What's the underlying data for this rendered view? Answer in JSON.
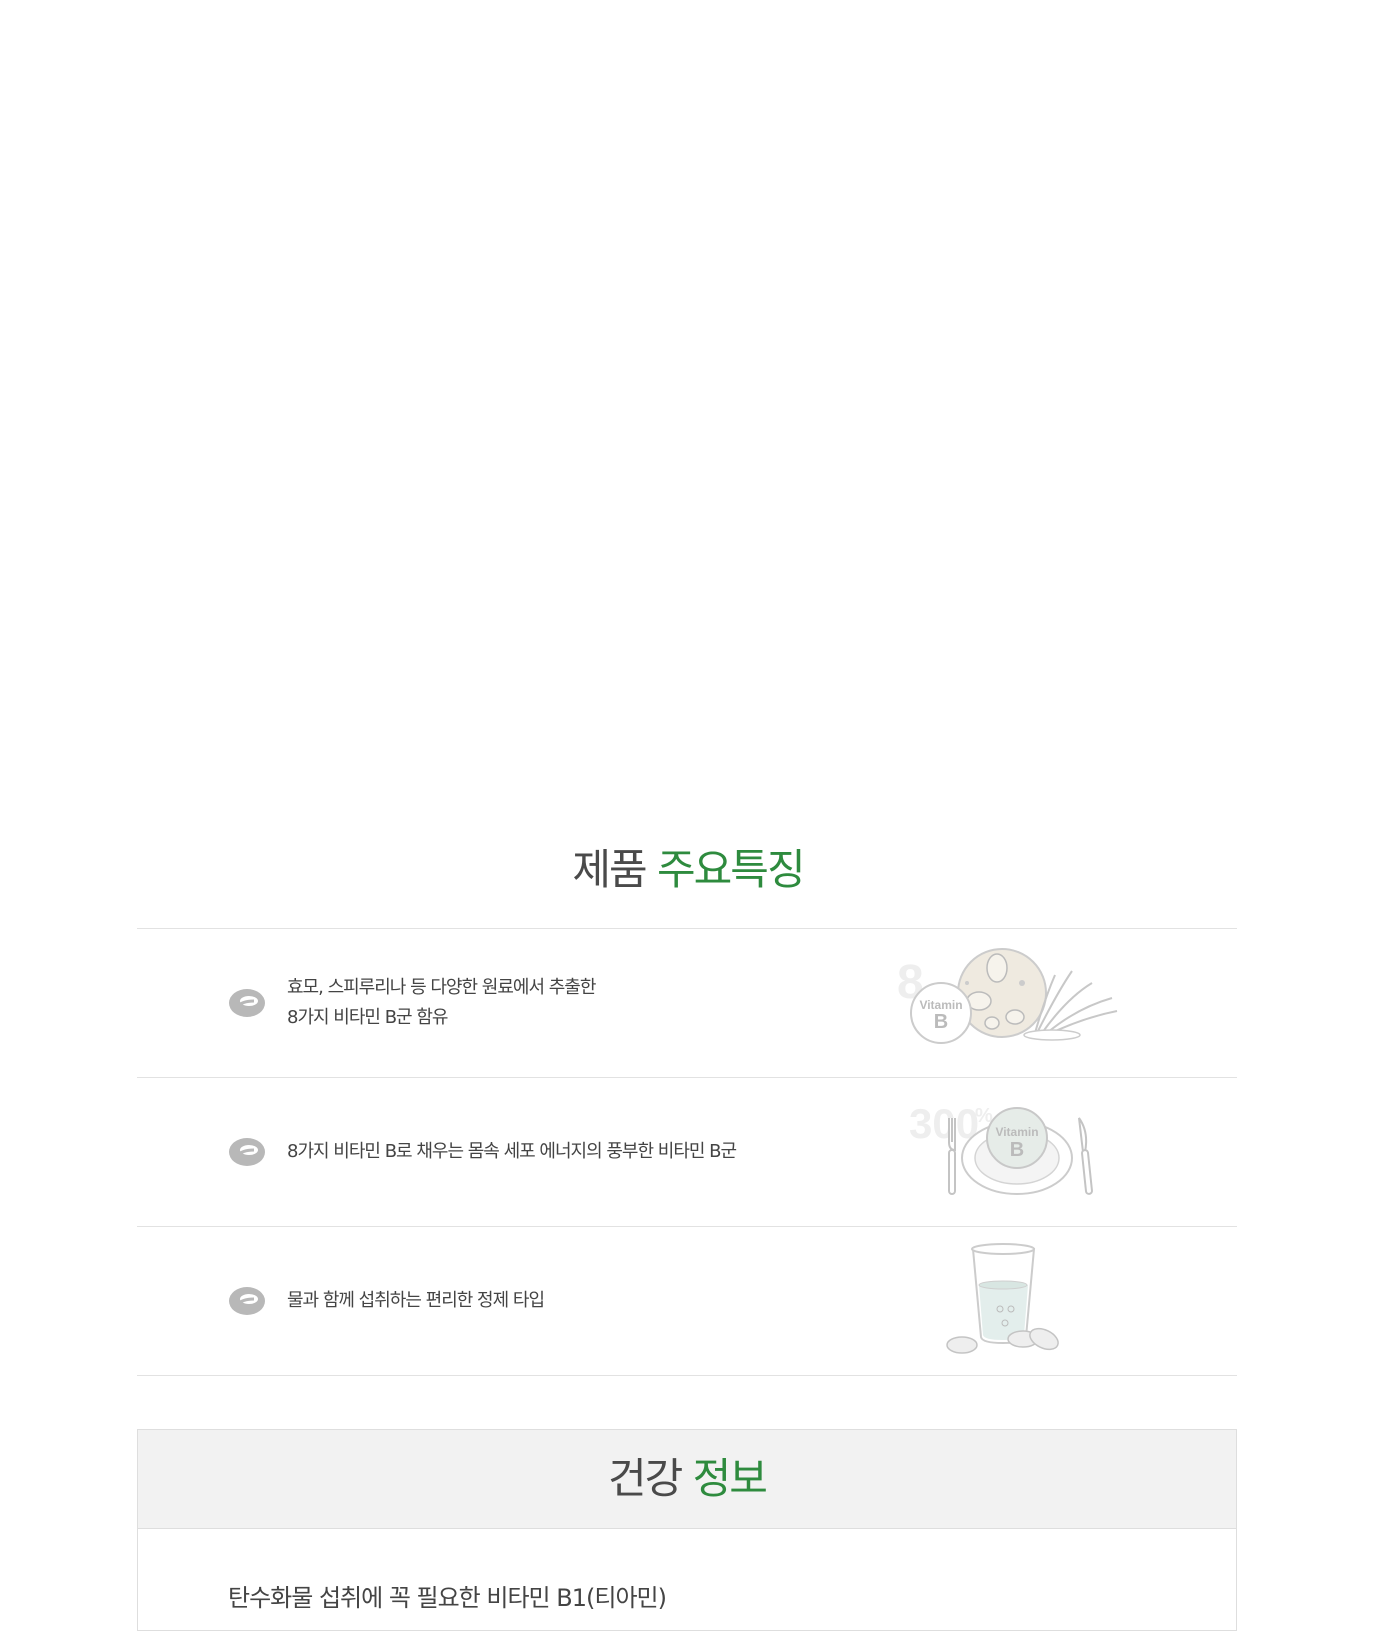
{
  "features": {
    "title_part1": "제품",
    "title_part2": "주요특징",
    "items": [
      {
        "line1": "효모, 스피루리나 등 다양한 원료에서 추출한",
        "line2": "8가지 비타민 B군 함유",
        "illustration": {
          "big_number": "8",
          "badge_top": "Vitamin",
          "badge_bottom": "B",
          "icon": "yeast-spirulina-icon"
        }
      },
      {
        "line1": "8가지 비타민 B로 채우는 몸속 세포 에너지의 풍부한 비타민 B군",
        "line2": "",
        "illustration": {
          "big_number": "300",
          "unit": "%",
          "badge_top": "Vitamin",
          "badge_bottom": "B",
          "icon": "plate-fork-knife-icon"
        }
      },
      {
        "line1": "물과 함께 섭취하는 편리한 정제 타입",
        "line2": "",
        "illustration": {
          "icon": "water-glass-tablets-icon"
        }
      }
    ]
  },
  "health": {
    "title_part1": "건강",
    "title_part2": "정보",
    "subtitle": "탄수화물 섭취에 꼭 필요한 비타민 B1(티아민)"
  },
  "colors": {
    "accent": "#2e8b3e",
    "text": "#444444",
    "line": "#e2e2e2",
    "header_bg": "#f2f2f2"
  }
}
